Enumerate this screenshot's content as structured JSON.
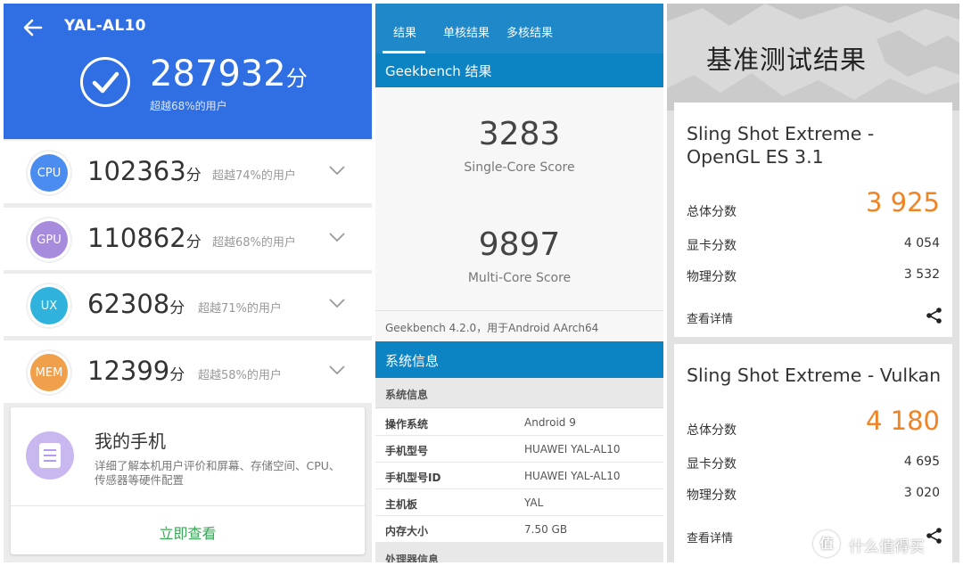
{
  "antutu": {
    "model": "YAL-AL10",
    "total_score": "287932",
    "unit": "分",
    "beat": "超越68%的用户",
    "rows": [
      {
        "badge": "CPU",
        "score": "102363",
        "unit": "分",
        "beat": "超越74%的用户",
        "color": "#4a8cf0"
      },
      {
        "badge": "GPU",
        "score": "110862",
        "unit": "分",
        "beat": "超越68%的用户",
        "color": "#a78bdc"
      },
      {
        "badge": "UX",
        "score": "62308",
        "unit": "分",
        "beat": "超越71%的用户",
        "color": "#2fb3dc"
      },
      {
        "badge": "MEM",
        "score": "12399",
        "unit": "分",
        "beat": "超越58%的用户",
        "color": "#f0a04a"
      }
    ],
    "card": {
      "title": "我的手机",
      "desc": "详细了解本机用户评价和屏幕、存储空间、CPU、传感器等硬件配置",
      "action": "立即查看"
    }
  },
  "geekbench": {
    "tabs": [
      "结果",
      "单核结果",
      "多核结果"
    ],
    "results_header": "Geekbench 结果",
    "single_score": "3283",
    "single_label": "Single-Core Score",
    "multi_score": "9897",
    "multi_label": "Multi-Core Score",
    "version": "Geekbench 4.2.0，用于Android AArch64",
    "sysinfo_header": "系统信息",
    "section1": "系统信息",
    "info": [
      {
        "k": "操作系统",
        "v": "Android 9"
      },
      {
        "k": "手机型号",
        "v": "HUAWEI YAL-AL10"
      },
      {
        "k": "手机型号ID",
        "v": "HUAWEI YAL-AL10"
      },
      {
        "k": "主机板",
        "v": "YAL"
      },
      {
        "k": "内存大小",
        "v": "7.50 GB"
      }
    ],
    "section2": "处理器信息"
  },
  "tdmark": {
    "heading": "基准测试结果",
    "cards": [
      {
        "name": "Sling Shot Extreme - OpenGL ES 3.1",
        "total_label": "总体分数",
        "total": "3 925",
        "gpu_label": "显卡分数",
        "gpu": "4 054",
        "phys_label": "物理分数",
        "phys": "3 532",
        "more": "查看详情"
      },
      {
        "name": "Sling Shot Extreme - Vulkan",
        "total_label": "总体分数",
        "total": "4 180",
        "gpu_label": "显卡分数",
        "gpu": "4 695",
        "phys_label": "物理分数",
        "phys": "3 020",
        "more": "查看详情"
      }
    ]
  },
  "watermark": {
    "logo": "值",
    "text": "什么值得买"
  },
  "colors": {
    "antutu_blue": "#2f6ee3",
    "geekbench_blue": "#0c84c4",
    "score_orange": "#f08323",
    "action_green": "#3aa757"
  }
}
